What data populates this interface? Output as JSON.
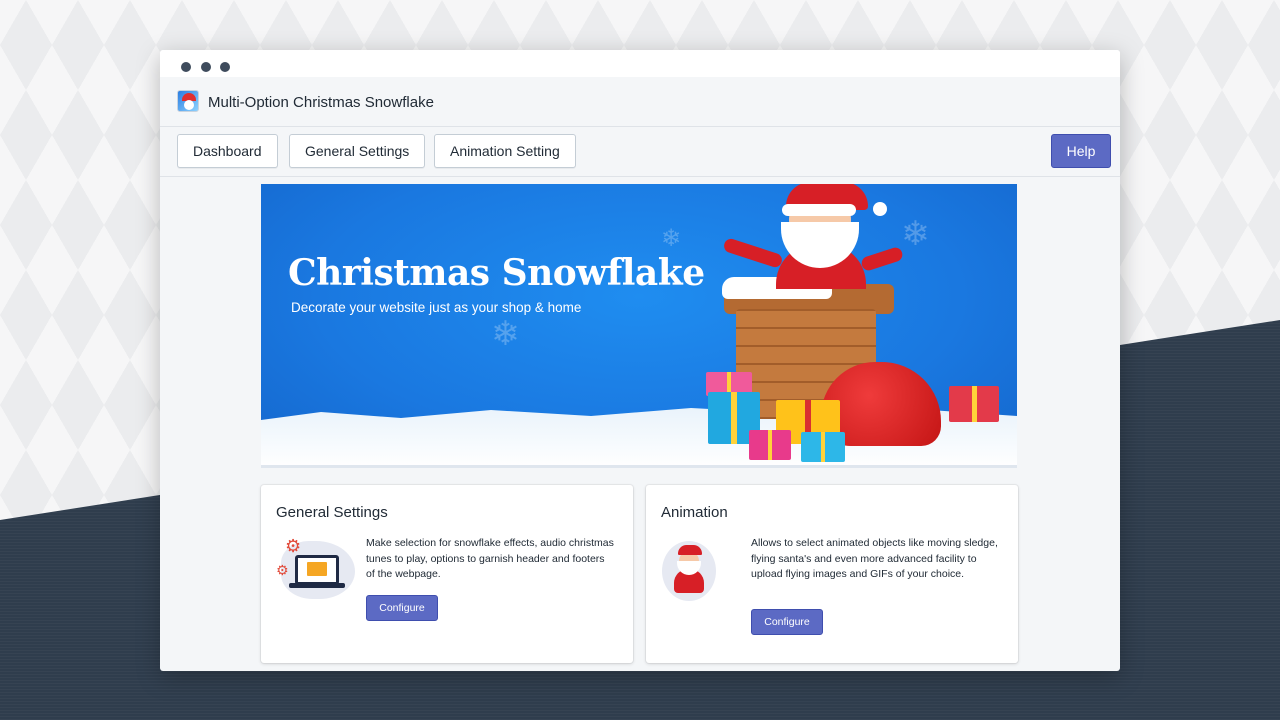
{
  "window": {
    "app_title": "Multi-Option Christmas Snowflake"
  },
  "navbar": {
    "tabs": [
      {
        "label": "Dashboard"
      },
      {
        "label": "General Settings"
      },
      {
        "label": "Animation Setting"
      }
    ],
    "help_label": "Help"
  },
  "banner": {
    "title": "Christmas Snowflake",
    "subtitle": "Decorate your website just as your shop & home"
  },
  "cards": [
    {
      "title": "General Settings",
      "description": "Make selection for snowflake effects, audio christmas tunes to play, options to garnish header and footers of the webpage.",
      "button_label": "Configure",
      "icon": "laptop-envelope-gears-icon"
    },
    {
      "title": "Animation",
      "description": "Allows to select animated objects like moving sledge, flying santa's and even more advanced facility to upload flying images and GIFs of your choice.",
      "button_label": "Configure",
      "icon": "santa-icon"
    }
  ],
  "colors": {
    "primary": "#5c6ac4",
    "banner_blue": "#1a78e0",
    "santa_red": "#d71f26"
  }
}
